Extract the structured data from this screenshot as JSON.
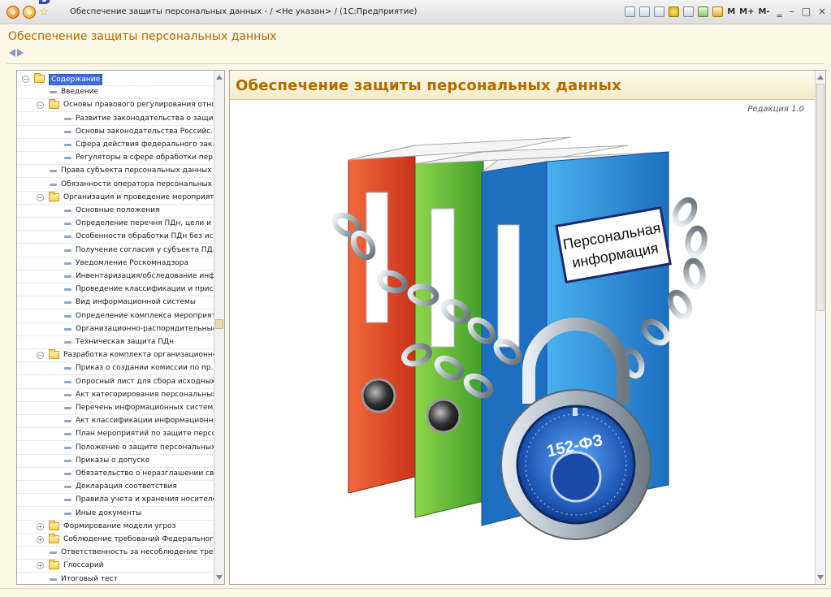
{
  "window": {
    "title": "Обеспечение защиты персональных данных - / <Не указан> / (1С:Предприятие)",
    "corner_letter": "В",
    "toolbar_keys": [
      "M",
      "M+",
      "M-"
    ],
    "controls": [
      "‗",
      "–",
      "□",
      "×"
    ]
  },
  "form": {
    "title": "Обеспечение защиты персональных данных"
  },
  "tree": {
    "items": [
      {
        "label": "Содержание",
        "level": 0,
        "kind": "folder",
        "expanded": true,
        "selected": true
      },
      {
        "label": "Введение",
        "level": 1,
        "kind": "doc"
      },
      {
        "label": "Основы правового регулирования отно...",
        "level": 1,
        "kind": "folder",
        "expanded": true
      },
      {
        "label": "Развитие законодательства о защи...",
        "level": 2,
        "kind": "doc"
      },
      {
        "label": "Основы законодательства Российс...",
        "level": 2,
        "kind": "doc"
      },
      {
        "label": "Сфера действия федерального зак...",
        "level": 2,
        "kind": "doc"
      },
      {
        "label": "Регуляторы в сфере обработки пер...",
        "level": 2,
        "kind": "doc"
      },
      {
        "label": "Права субъекта персональных данных",
        "level": 1,
        "kind": "doc"
      },
      {
        "label": "Обязанности оператора персональных ...",
        "level": 1,
        "kind": "doc"
      },
      {
        "label": "Организация и проведение мероприяти...",
        "level": 1,
        "kind": "folder",
        "expanded": true
      },
      {
        "label": "Основные положения",
        "level": 2,
        "kind": "doc"
      },
      {
        "label": "Определение перечня ПДн, цели и ...",
        "level": 2,
        "kind": "doc"
      },
      {
        "label": "Особенности обработки ПДн без ис...",
        "level": 2,
        "kind": "doc"
      },
      {
        "label": "Получение согласия у субъекта ПД...",
        "level": 2,
        "kind": "doc"
      },
      {
        "label": "Уведомление Роскомнадзора",
        "level": 2,
        "kind": "doc"
      },
      {
        "label": "Инвентаризация/обследование инф...",
        "level": 2,
        "kind": "doc"
      },
      {
        "label": "Проведение классификации и прис...",
        "level": 2,
        "kind": "doc"
      },
      {
        "label": "Вид информационной системы",
        "level": 2,
        "kind": "doc"
      },
      {
        "label": "Определение комплекса мероприят...",
        "level": 2,
        "kind": "doc"
      },
      {
        "label": "Организационно-распорядительные...",
        "level": 2,
        "kind": "doc"
      },
      {
        "label": "Техническая защита ПДн",
        "level": 2,
        "kind": "doc"
      },
      {
        "label": "Разработка комплекта организационно...",
        "level": 1,
        "kind": "folder",
        "expanded": true
      },
      {
        "label": "Приказ о создании комиссии по пр...",
        "level": 2,
        "kind": "doc"
      },
      {
        "label": "Опросный лист для сбора исходных...",
        "level": 2,
        "kind": "doc"
      },
      {
        "label": "Акт категорирования персональных...",
        "level": 2,
        "kind": "doc"
      },
      {
        "label": "Перечень информационных систем",
        "level": 2,
        "kind": "doc"
      },
      {
        "label": "Акт классификации информационн...",
        "level": 2,
        "kind": "doc"
      },
      {
        "label": "План мероприятий по защите персо...",
        "level": 2,
        "kind": "doc"
      },
      {
        "label": "Положение о защите персональных...",
        "level": 2,
        "kind": "doc"
      },
      {
        "label": "Приказы о допуске",
        "level": 2,
        "kind": "doc"
      },
      {
        "label": "Обязательство о неразглашении св...",
        "level": 2,
        "kind": "doc"
      },
      {
        "label": "Декларация соответствия",
        "level": 2,
        "kind": "doc"
      },
      {
        "label": "Правила учета и хранения носителе...",
        "level": 2,
        "kind": "doc"
      },
      {
        "label": "Иные документы",
        "level": 2,
        "kind": "doc"
      },
      {
        "label": "Формирование модели угроз",
        "level": 1,
        "kind": "folder",
        "expanded": false
      },
      {
        "label": "Соблюдение требований Федерального ...",
        "level": 1,
        "kind": "folder",
        "expanded": false
      },
      {
        "label": "Ответственность за несоблюдение тре...",
        "level": 1,
        "kind": "doc"
      },
      {
        "label": "Глоссарий",
        "level": 1,
        "kind": "folder",
        "expanded": false
      },
      {
        "label": "Итоговый тест",
        "level": 1,
        "kind": "doc"
      }
    ]
  },
  "content": {
    "heading": "Обеспечение защиты персональных данных",
    "edition": "Редакция 1.0",
    "binder_label_line1": "Персональная",
    "binder_label_line2": "информация",
    "lock_label": "152-ФЗ"
  },
  "colors": {
    "accent_text": "#b36a00",
    "selection": "#3a6edc",
    "panel_bg": "#fbf7e6"
  }
}
